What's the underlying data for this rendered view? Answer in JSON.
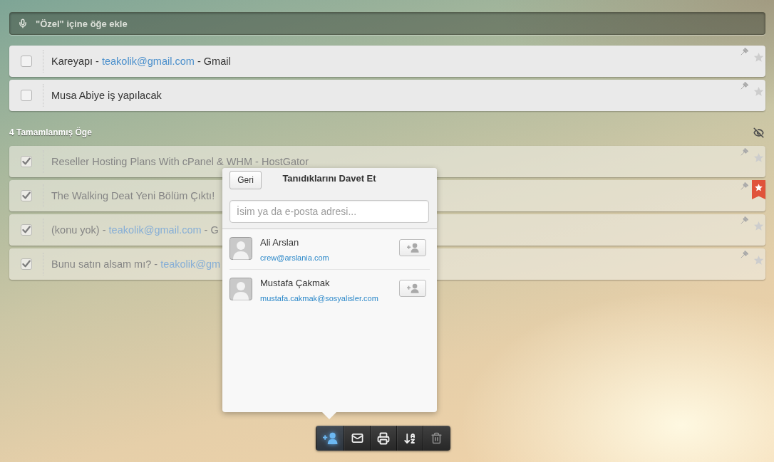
{
  "add_task": {
    "placeholder": "\"Özel\" içine öğe ekle"
  },
  "tasks": [
    {
      "checked": false,
      "starred": false,
      "segments": [
        {
          "kind": "text",
          "text": "Kareyapı - "
        },
        {
          "kind": "link",
          "text": "teakolik@gmail.com"
        },
        {
          "kind": "text",
          "text": " - Gmail"
        }
      ]
    },
    {
      "checked": false,
      "starred": false,
      "segments": [
        {
          "kind": "text",
          "text": "Musa Abiye iş yapılacak"
        }
      ]
    }
  ],
  "completed": {
    "heading": "4 Tamamlanmış Öge",
    "items": [
      {
        "checked": true,
        "starred": false,
        "segments": [
          {
            "kind": "text",
            "text": "Reseller Hosting Plans With cPanel & WHM - HostGator"
          }
        ]
      },
      {
        "checked": true,
        "starred": true,
        "segments": [
          {
            "kind": "text",
            "text": "The Walking Deat Yeni Bölüm Çıktı!"
          }
        ]
      },
      {
        "checked": true,
        "starred": false,
        "segments": [
          {
            "kind": "text",
            "text": "(konu yok) - "
          },
          {
            "kind": "link",
            "text": "teakolik@gmail.com"
          },
          {
            "kind": "text",
            "text": " - G"
          }
        ]
      },
      {
        "checked": true,
        "starred": false,
        "segments": [
          {
            "kind": "text",
            "text": "Bunu satın alsam mı? - "
          },
          {
            "kind": "link",
            "text": "teakolik@gm"
          }
        ]
      }
    ]
  },
  "invite_popover": {
    "back_button": "Geri",
    "title": "Tanıdıklarını Davet Et",
    "search": {
      "placeholder": "İsim ya da e-posta adresi..."
    },
    "contacts": [
      {
        "name": "Ali Arslan",
        "email": "crew@arslania.com"
      },
      {
        "name": "Mustafa Çakmak",
        "email": "mustafa.cakmak@sosyalisler.com"
      }
    ]
  },
  "toolbar": [
    {
      "kind": "share",
      "selected": true,
      "disabled": false
    },
    {
      "kind": "email",
      "selected": false,
      "disabled": false
    },
    {
      "kind": "print",
      "selected": false,
      "disabled": false
    },
    {
      "kind": "sort",
      "selected": false,
      "disabled": false
    },
    {
      "kind": "delete",
      "selected": false,
      "disabled": true
    }
  ]
}
